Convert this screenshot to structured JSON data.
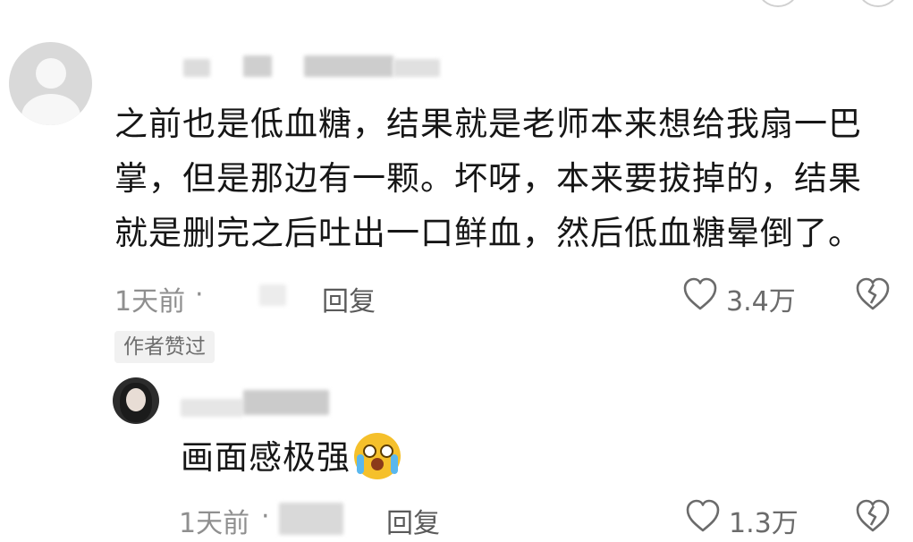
{
  "comment": {
    "text": "之前也是低血糖，结果就是老师本来想给我扇一巴掌，但是那边有一颗。坏呀，本来要拔掉的，结果就是删完之后吐出一口鲜血，然后低血糖晕倒了。",
    "time": "1天前",
    "dot": "·",
    "reply_label": "回复",
    "like_count": "3.4万",
    "author_badge": "作者赞过"
  },
  "reply": {
    "text": "画面感极强",
    "emoji_icon": "crying-face-emoji",
    "time": "1天前",
    "dot": "·",
    "reply_label": "回复",
    "like_count": "1.3万"
  },
  "colors": {
    "text": "#161616",
    "meta": "#8f8f8f",
    "badge_bg": "#f1f1f1"
  }
}
